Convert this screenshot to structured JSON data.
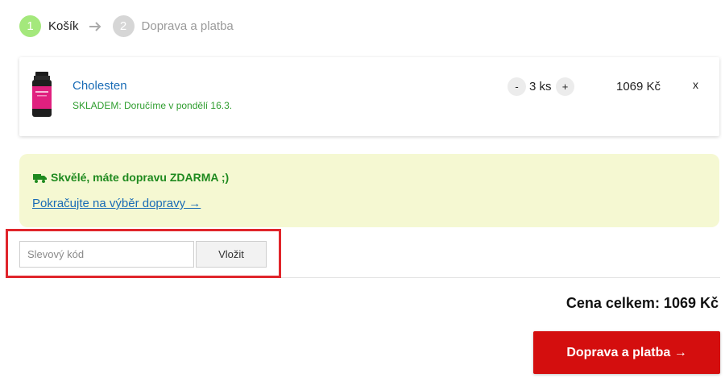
{
  "steps": [
    {
      "number": "1",
      "label": "Košík",
      "state": "active"
    },
    {
      "number": "2",
      "label": "Doprava a platba",
      "state": "inactive"
    }
  ],
  "step_arrow_icon": "arrow-right-icon",
  "cart": {
    "item": {
      "name": "Cholesten",
      "stock": "SKLADEM: Doručíme v pondělí 16.3.",
      "qty_minus": "-",
      "quantity": "3 ks",
      "qty_plus": "+",
      "price": "1069 Kč",
      "remove": "x",
      "image_icon": "supplement-bottle-icon"
    }
  },
  "shipping": {
    "message": "Skvělé, máte dopravu ZDARMA ;)",
    "link": "Pokračujte na výběr dopravy →",
    "icon": "truck-icon"
  },
  "discount": {
    "placeholder": "Slevový kód",
    "value": "",
    "button": "Vložit"
  },
  "total": "Cena celkem: 1069 Kč",
  "checkout_button": "Doprava a platba →",
  "colors": {
    "accent_green": "#a4e87c",
    "link_blue": "#1a6cb6",
    "stock_green": "#2e9d2e",
    "shipping_bg": "#f5f8d2",
    "checkout_red": "#d40e0e",
    "highlight_red": "#e0252b"
  }
}
